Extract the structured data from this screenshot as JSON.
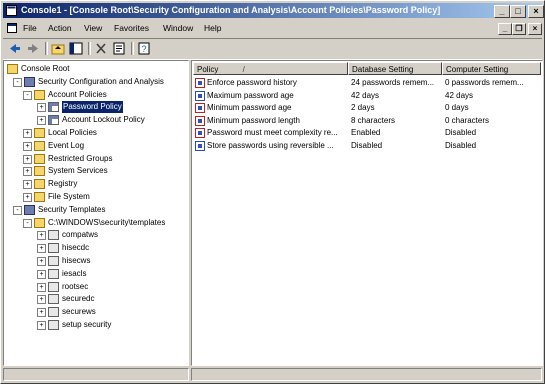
{
  "window": {
    "title": "Console1 - [Console Root\\Security Configuration and Analysis\\Account Policies\\Password Policy]",
    "controls": {
      "minimize": "_",
      "maximize": "□",
      "close": "×"
    }
  },
  "menu": {
    "items": [
      "File",
      "Action",
      "View",
      "Favorites",
      "Window",
      "Help"
    ],
    "mdi_controls": {
      "minimize": "_",
      "restore": "❐",
      "close": "×"
    }
  },
  "toolbar": {
    "buttons": [
      "back-icon",
      "forward-icon",
      "up-folder-icon",
      "show-hide-tree-icon",
      "delete-icon",
      "properties-icon",
      "help-icon"
    ]
  },
  "tree": {
    "nodes": [
      {
        "label": "Console Root",
        "icon": "folder-icon",
        "level": 0,
        "expander": ""
      },
      {
        "label": "Security Configuration and Analysis",
        "icon": "security-analysis-icon",
        "level": 1,
        "expander": "-"
      },
      {
        "label": "Account Policies",
        "icon": "folder-icon",
        "level": 2,
        "expander": "-"
      },
      {
        "label": "Password Policy",
        "icon": "policy-folder-icon",
        "level": 3,
        "expander": "+",
        "selected": true
      },
      {
        "label": "Account Lockout Policy",
        "icon": "policy-folder-icon",
        "level": 3,
        "expander": "+"
      },
      {
        "label": "Local Policies",
        "icon": "folder-icon",
        "level": 2,
        "expander": "+"
      },
      {
        "label": "Event Log",
        "icon": "folder-icon",
        "level": 2,
        "expander": "+"
      },
      {
        "label": "Restricted Groups",
        "icon": "folder-icon",
        "level": 2,
        "expander": "+"
      },
      {
        "label": "System Services",
        "icon": "folder-icon",
        "level": 2,
        "expander": "+"
      },
      {
        "label": "Registry",
        "icon": "folder-icon",
        "level": 2,
        "expander": "+"
      },
      {
        "label": "File System",
        "icon": "folder-icon",
        "level": 2,
        "expander": "+"
      },
      {
        "label": "Security Templates",
        "icon": "templates-icon",
        "level": 1,
        "expander": "-"
      },
      {
        "label": "C:\\WINDOWS\\security\\templates",
        "icon": "folder-icon",
        "level": 2,
        "expander": "-"
      },
      {
        "label": "compatws",
        "icon": "template-icon",
        "level": 3,
        "expander": "+"
      },
      {
        "label": "hisecdc",
        "icon": "template-icon",
        "level": 3,
        "expander": "+"
      },
      {
        "label": "hisecws",
        "icon": "template-icon",
        "level": 3,
        "expander": "+"
      },
      {
        "label": "iesacls",
        "icon": "template-icon",
        "level": 3,
        "expander": "+"
      },
      {
        "label": "rootsec",
        "icon": "template-icon",
        "level": 3,
        "expander": "+"
      },
      {
        "label": "securedc",
        "icon": "template-icon",
        "level": 3,
        "expander": "+"
      },
      {
        "label": "securews",
        "icon": "template-icon",
        "level": 3,
        "expander": "+"
      },
      {
        "label": "setup security",
        "icon": "template-icon",
        "level": 3,
        "expander": "+"
      }
    ]
  },
  "list": {
    "columns": [
      "Policy",
      "Database Setting",
      "Computer Setting"
    ],
    "sort_indicator": "/",
    "rows": [
      {
        "policy": "Enforce password history",
        "database": "24 passwords remem...",
        "computer": "0 passwords remem...",
        "flag": "mismatch"
      },
      {
        "policy": "Maximum password age",
        "database": "42 days",
        "computer": "42 days",
        "flag": "match"
      },
      {
        "policy": "Minimum password age",
        "database": "2 days",
        "computer": "0 days",
        "flag": "mismatch"
      },
      {
        "policy": "Minimum password length",
        "database": "8 characters",
        "computer": "0 characters",
        "flag": "mismatch"
      },
      {
        "policy": "Password must meet complexity re...",
        "database": "Enabled",
        "computer": "Disabled",
        "flag": "mismatch"
      },
      {
        "policy": "Store passwords using reversible ...",
        "database": "Disabled",
        "computer": "Disabled",
        "flag": "match"
      }
    ]
  },
  "colors": {
    "title_start": "#0a246a",
    "title_end": "#a6caf0",
    "selection": "#0a246a",
    "face": "#d4d0c8"
  }
}
